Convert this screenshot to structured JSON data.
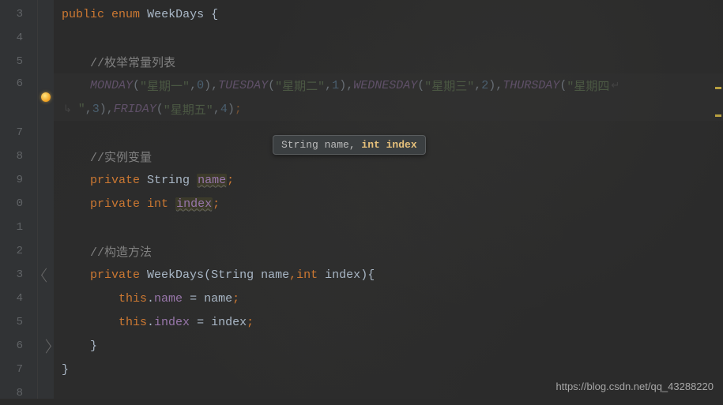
{
  "lines": [
    {
      "num": "3"
    },
    {
      "num": "4"
    },
    {
      "num": "5"
    },
    {
      "num": "6"
    },
    {
      "num": "7"
    },
    {
      "num": "8"
    },
    {
      "num": "9"
    },
    {
      "num": "0"
    },
    {
      "num": "1"
    },
    {
      "num": "2"
    },
    {
      "num": "3"
    },
    {
      "num": "4"
    },
    {
      "num": "5"
    },
    {
      "num": "6"
    },
    {
      "num": "7"
    },
    {
      "num": "8"
    }
  ],
  "code": {
    "l3": {
      "kw1": "public",
      "kw2": "enum",
      "name": "WeekDays",
      "brace": " {"
    },
    "l5": "//枚举常量列表",
    "l6a": {
      "e1": "MONDAY",
      "s1": "\"星期一\"",
      "n1": "0",
      "e2": "TUESDAY",
      "s2": "\"星期二\"",
      "n2": "1",
      "e3": "WEDNESDAY",
      "s3": "\"星期三\"",
      "n3": "2",
      "e4": "THURSDAY",
      "s4": "\"星期四"
    },
    "l6b": {
      "cont": "\"",
      "n4": "3",
      "e5": "FRIDAY",
      "s5": "\"星期五\"",
      "n5": "4"
    },
    "l8": "//实例变量",
    "l9": {
      "kw": "private",
      "type": "String",
      "name": "name",
      "semi": ";"
    },
    "l10": {
      "kw": "private",
      "type": "int",
      "name": "index",
      "semi": ";"
    },
    "l12": "//构造方法",
    "l13": {
      "kw": "private",
      "cls": "WeekDays",
      "p1t": "String",
      "p1n": "name",
      "p2t": "int",
      "p2n": "index"
    },
    "l14": {
      "kw": "this",
      "f": "name",
      "eq": " = ",
      "v": "name",
      "semi": ";"
    },
    "l15": {
      "kw": "this",
      "f": "index",
      "eq": " = ",
      "v": "index",
      "semi": ";"
    },
    "l16": "}",
    "l17": "}"
  },
  "tooltip": {
    "p1": "String name, ",
    "p2": "int index"
  },
  "watermark": "https://blog.csdn.net/qq_43288220"
}
